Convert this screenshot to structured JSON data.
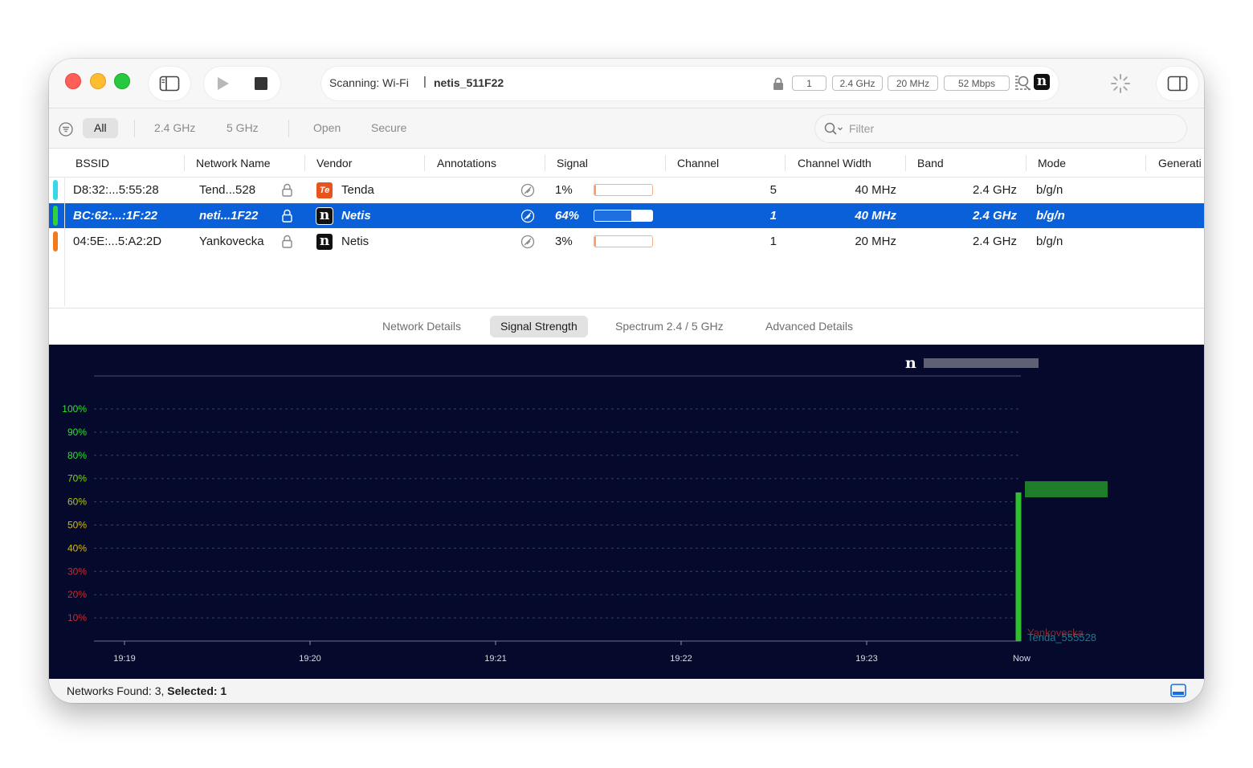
{
  "toolbar": {
    "scanning_label": "Scanning: Wi-Fi",
    "separator": "|",
    "network": "netis_511F22",
    "channel": "1",
    "band": "2.4 GHz",
    "width": "20 MHz",
    "rate": "52 Mbps"
  },
  "filters": {
    "segments": [
      "All",
      "2.4 GHz",
      "5 GHz",
      "Open",
      "Secure"
    ],
    "placeholder": "Filter"
  },
  "table": {
    "columns": [
      "BSSID",
      "Network Name",
      "Vendor",
      "Annotations",
      "Signal",
      "Channel",
      "Channel Width",
      "Band",
      "Mode",
      "Generati"
    ],
    "rows": [
      {
        "color": "#35d7e8",
        "bssid": "D8:32:...5:55:28",
        "name": "Tend...528",
        "vendor": "Tenda",
        "vendor_icon": "tenda-logo-icon",
        "signal": "1%",
        "signal_value": 0.01,
        "channel": "5",
        "width": "40 MHz",
        "band": "2.4 GHz",
        "mode": "b/g/n"
      },
      {
        "color": "#2fd23a",
        "bssid": "BC:62:...:1F:22",
        "name": "neti...1F22",
        "vendor": "Netis",
        "vendor_icon": "netis-logo-icon",
        "signal": "64%",
        "signal_value": 0.64,
        "channel": "1",
        "width": "40 MHz",
        "band": "2.4 GHz",
        "mode": "b/g/n"
      },
      {
        "color": "#f07a1e",
        "bssid": "04:5E:...5:A2:2D",
        "name": "Yankovecka",
        "vendor": "Netis",
        "vendor_icon": "netis-logo-icon",
        "signal": "3%",
        "signal_value": 0.03,
        "channel": "1",
        "width": "20 MHz",
        "band": "2.4 GHz",
        "mode": "b/g/n"
      }
    ]
  },
  "tabs": [
    "Network Details",
    "Signal Strength",
    "Spectrum 2.4 / 5 GHz",
    "Advanced Details"
  ],
  "chart_data": {
    "type": "line",
    "y_ticks": [
      "100%",
      "90%",
      "80%",
      "70%",
      "60%",
      "50%",
      "40%",
      "30%",
      "20%",
      "10%"
    ],
    "x_ticks": [
      "19:19",
      "19:20",
      "19:21",
      "19:22",
      "19:23",
      "Now"
    ],
    "ylim": [
      0,
      100
    ],
    "series": [
      {
        "name": "netis_511F22",
        "color": "#2fbf2f",
        "x": [
          "Now"
        ],
        "y": [
          64
        ]
      },
      {
        "name": "Yankovecka",
        "color": "#8a2a2a",
        "x": [
          "Now"
        ],
        "y": [
          3
        ]
      },
      {
        "name": "Tenda_555528",
        "color": "#1a7a8a",
        "x": [
          "Now"
        ],
        "y": [
          1
        ]
      }
    ],
    "legend_top": "n"
  },
  "status": {
    "prefix": "Networks Found: 3, ",
    "selected": "Selected: 1"
  }
}
